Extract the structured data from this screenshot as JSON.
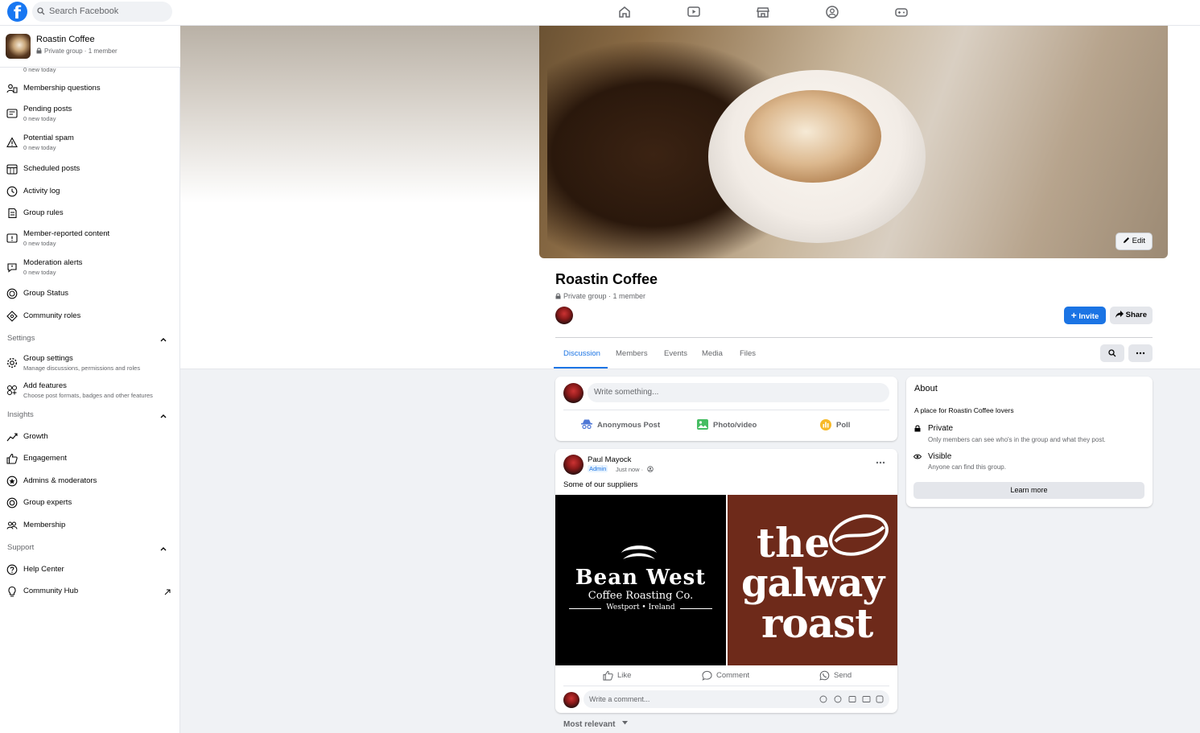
{
  "topbar": {
    "search_placeholder": "Search Facebook"
  },
  "sidebar": {
    "group_name": "Roastin Coffee",
    "group_sub": "Private group · 1 member",
    "partial_sub": "0 new today",
    "items": [
      {
        "label": "Membership questions",
        "sub": ""
      },
      {
        "label": "Pending posts",
        "sub": "0 new today"
      },
      {
        "label": "Potential spam",
        "sub": "0 new today"
      },
      {
        "label": "Scheduled posts",
        "sub": ""
      },
      {
        "label": "Activity log",
        "sub": ""
      },
      {
        "label": "Group rules",
        "sub": ""
      },
      {
        "label": "Member-reported content",
        "sub": "0 new today"
      },
      {
        "label": "Moderation alerts",
        "sub": "0 new today"
      },
      {
        "label": "Group Status",
        "sub": ""
      },
      {
        "label": "Community roles",
        "sub": ""
      }
    ],
    "settings": {
      "header": "Settings",
      "items": [
        {
          "label": "Group settings",
          "sub": "Manage discussions, permissions and roles"
        },
        {
          "label": "Add features",
          "sub": "Choose post formats, badges and other features"
        }
      ]
    },
    "insights": {
      "header": "Insights",
      "items": [
        "Growth",
        "Engagement",
        "Admins & moderators",
        "Group experts",
        "Membership"
      ]
    },
    "support": {
      "header": "Support",
      "items": [
        "Help Center",
        "Community Hub"
      ]
    }
  },
  "cover": {
    "edit_label": "Edit"
  },
  "group": {
    "title": "Roastin Coffee",
    "sub": "Private group · 1 member",
    "invite_label": "Invite",
    "share_label": "Share",
    "tabs": [
      "Discussion",
      "Members",
      "Events",
      "Media",
      "Files"
    ]
  },
  "composer": {
    "placeholder": "Write something...",
    "actions": [
      "Anonymous Post",
      "Photo/video",
      "Poll"
    ]
  },
  "post": {
    "author": "Paul Mayock",
    "badge": "Admin",
    "time": "Just now ·",
    "text": "Some of our suppliers",
    "image1": {
      "line1": "Bean West",
      "line2": "Coffee Roasting Co.",
      "line3": "Westport • Ireland"
    },
    "image2": {
      "line1": "the",
      "line2": "galway",
      "line3": "roast"
    },
    "actions": [
      "Like",
      "Comment",
      "Send"
    ],
    "comment_placeholder": "Write a comment...",
    "sort_label": "Most relevant"
  },
  "about": {
    "title": "About",
    "description": "A place for Roastin Coffee lovers",
    "private_title": "Private",
    "private_desc": "Only members can see who's in the group and what they post.",
    "visible_title": "Visible",
    "visible_desc": "Anyone can find this group.",
    "learn_more": "Learn more"
  },
  "colors": {
    "accent": "#1b74e4",
    "background": "#f0f2f5"
  }
}
